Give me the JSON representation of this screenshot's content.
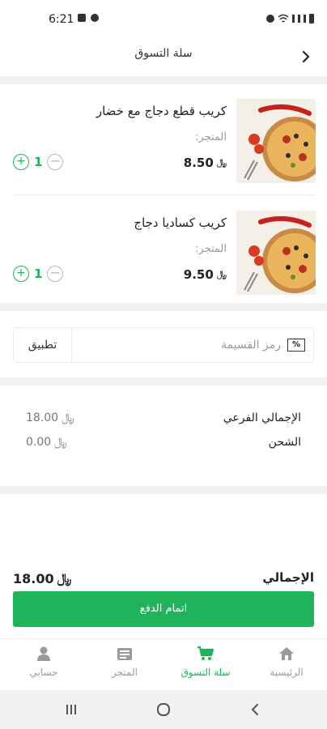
{
  "status_bar": {
    "time": "6:21"
  },
  "header": {
    "title": "سلة التسوق"
  },
  "cart": {
    "items": [
      {
        "name": "كريب قطع دجاج مع خضار",
        "store_label": "المتجر:",
        "price": "8.50",
        "currency": "﷼",
        "quantity": "1"
      },
      {
        "name": "كريب كساديا دجاج",
        "store_label": "المتجر:",
        "price": "9.50",
        "currency": "﷼",
        "quantity": "1"
      }
    ]
  },
  "coupon": {
    "placeholder": "رمز القسيمة",
    "apply_label": "تطبيق",
    "icon": "percent-icon"
  },
  "summary": {
    "subtotal_label": "الإجمالي الفرعي",
    "subtotal_value": "18.00",
    "shipping_label": "الشحن",
    "shipping_value": "0.00",
    "currency": "﷼"
  },
  "total": {
    "label": "الإجمالي",
    "value": "18.00",
    "currency": "﷼"
  },
  "checkout": {
    "label": "اتمام الدفع"
  },
  "bottom_nav": {
    "items": [
      {
        "label": "الرئيسية",
        "icon": "home-icon",
        "active": false
      },
      {
        "label": "سلة التسوق",
        "icon": "cart-icon",
        "active": true
      },
      {
        "label": "المتجر",
        "icon": "store-icon",
        "active": false
      },
      {
        "label": "حسابي",
        "icon": "user-icon",
        "active": false
      }
    ]
  },
  "colors": {
    "accent": "#1fb35c",
    "background": "#f1f1f1"
  }
}
